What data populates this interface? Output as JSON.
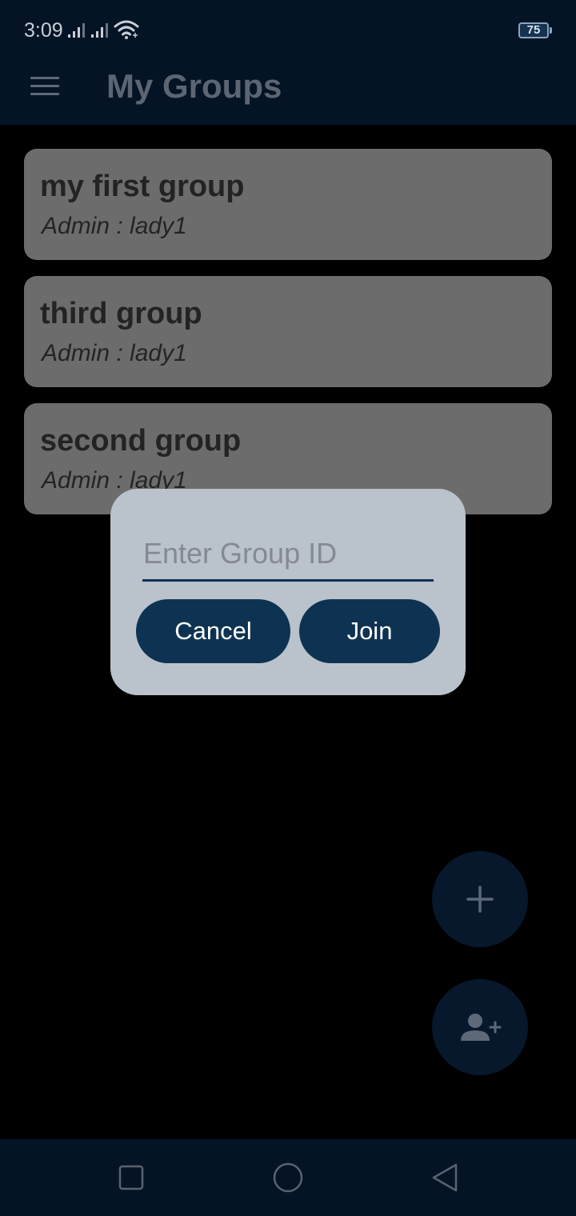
{
  "status_bar": {
    "time": "3:09",
    "battery_level": "75",
    "icons": [
      "signal-icon",
      "signal-icon",
      "wifi-icon",
      "battery-icon"
    ]
  },
  "app_bar": {
    "title": "My Groups",
    "menu_icon": "hamburger-menu-icon"
  },
  "groups": [
    {
      "name": "my first group",
      "admin": "Admin : lady1"
    },
    {
      "name": "third group",
      "admin": "Admin : lady1"
    },
    {
      "name": "second group",
      "admin": "Admin : lady1"
    }
  ],
  "dialog": {
    "input_placeholder": "Enter Group ID",
    "input_value": "",
    "cancel_label": "Cancel",
    "join_label": "Join"
  },
  "fabs": {
    "create_icon": "plus-icon",
    "join_icon": "add-person-icon"
  },
  "nav_bar": {
    "icons": [
      "square-recents-icon",
      "circle-home-icon",
      "triangle-back-icon"
    ]
  },
  "colors": {
    "bar_background": "#041425",
    "card_background": "#6c6c6c",
    "dialog_background": "#bac2cb",
    "button_background": "#0e3352",
    "page_background": "#000000"
  }
}
